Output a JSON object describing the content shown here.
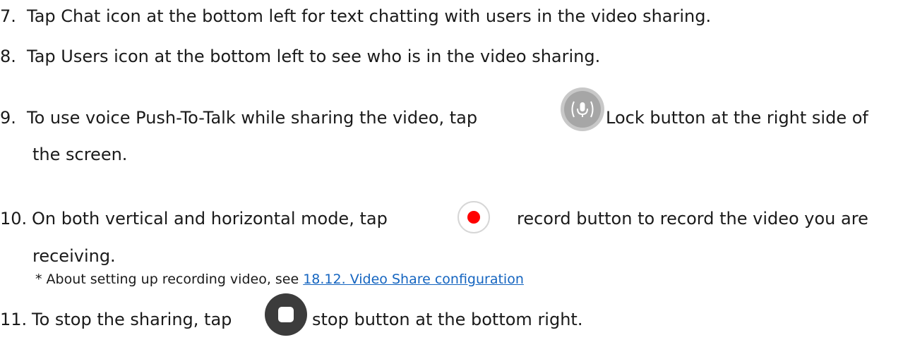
{
  "items": [
    {
      "number": "7.",
      "text": "Tap Chat icon at the bottom left for text chatting with users in the video sharing."
    },
    {
      "number": "8.",
      "text": "Tap Users icon at the bottom left to see who is in the video sharing."
    },
    {
      "number": "9.",
      "text_before_icon": "To use voice Push-To-Talk while sharing the video, tap",
      "text_after_icon": "Lock button at the right side of",
      "continuation": "the screen.",
      "icon": "microphone-lock-icon"
    },
    {
      "number": "10.",
      "text_before_icon": "On both vertical and horizontal mode, tap",
      "text_after_icon": "record button to record the video you are",
      "continuation": "receiving.",
      "icon": "record-icon",
      "note_prefix": "* About setting up recording video, see ",
      "note_link": "18.12. Video Share configuration"
    },
    {
      "number": "11.",
      "text_before_icon": "To stop the sharing, tap",
      "text_after_icon": "stop button at the bottom right.",
      "icon": "stop-icon"
    }
  ],
  "colors": {
    "text": "#1a1a1a",
    "link": "#1565c0",
    "record_red": "#ff0000",
    "icon_gray": "#9e9e9e",
    "stop_dark": "#3c3c3c"
  }
}
